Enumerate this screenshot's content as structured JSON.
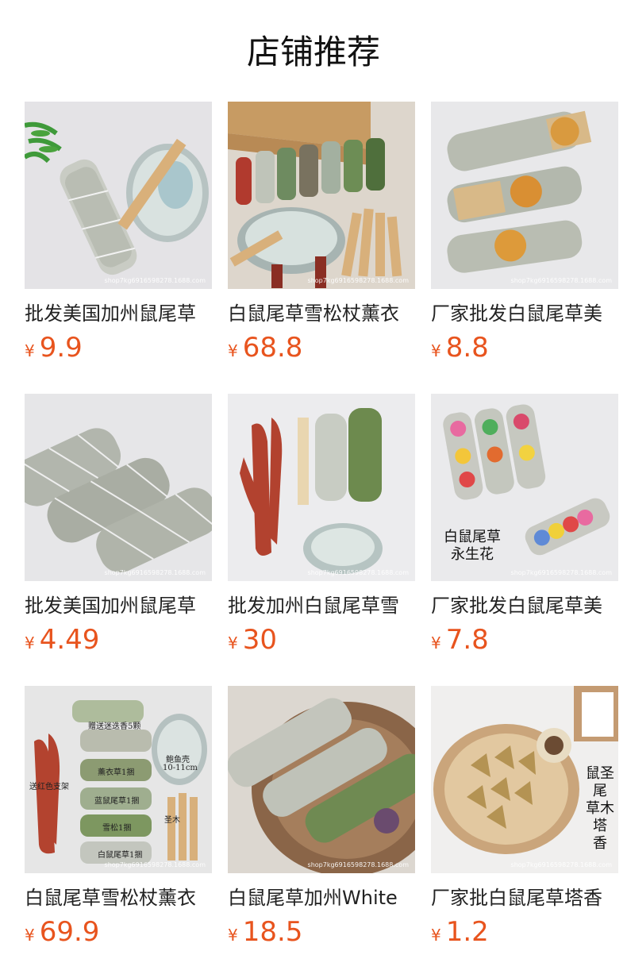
{
  "page": {
    "title": "店铺推荐"
  },
  "colors": {
    "price": "#e8541e",
    "title": "#111111",
    "name": "#222222"
  },
  "products": [
    {
      "name": "批发美国加州鼠尾草",
      "currency": "¥",
      "price": "9.9",
      "image": "white-sage-bundle-with-abalone-shell"
    },
    {
      "name": "白鼠尾草雪松杖薰衣",
      "currency": "¥",
      "price": "68.8",
      "image": "sage-cedar-bundles-with-palo-santo-and-shell"
    },
    {
      "name": "厂家批发白鼠尾草美",
      "currency": "¥",
      "price": "8.8",
      "image": "sage-bundles-with-orange-slices"
    },
    {
      "name": "批发美国加州鼠尾草",
      "currency": "¥",
      "price": "4.49",
      "image": "stacked-white-sage-bundles"
    },
    {
      "name": "批发加州白鼠尾草雪",
      "currency": "¥",
      "price": "30",
      "image": "sage-cedar-stand-and-shell"
    },
    {
      "name": "厂家批发白鼠尾草美",
      "currency": "¥",
      "price": "7.8",
      "image": "rainbow-flower-sage-bundles",
      "overlay": [
        "白鼠尾草",
        "永生花"
      ]
    },
    {
      "name": "白鼠尾草雪松杖薰衣",
      "currency": "¥",
      "price": "69.9",
      "image": "sage-kit-with-labels",
      "overlay": [
        "赠送迷迭香5颗",
        "鲍鱼壳",
        "10-11cm",
        "送红色支架",
        "薰衣草1捆",
        "蓝鼠尾草1捆",
        "雪松1捆",
        "白鼠尾草1捆",
        "圣木"
      ]
    },
    {
      "name": "白鼠尾草加州White",
      "currency": "¥",
      "price": "18.5",
      "image": "sage-bundles-on-wood-slice"
    },
    {
      "name": "厂家批白鼠尾草塔香",
      "currency": "¥",
      "price": "1.2",
      "image": "cone-incense-on-wood-plate",
      "overlay": [
        "鼠",
        "尾",
        "草",
        "塔",
        "香",
        "圣",
        "木"
      ]
    }
  ]
}
